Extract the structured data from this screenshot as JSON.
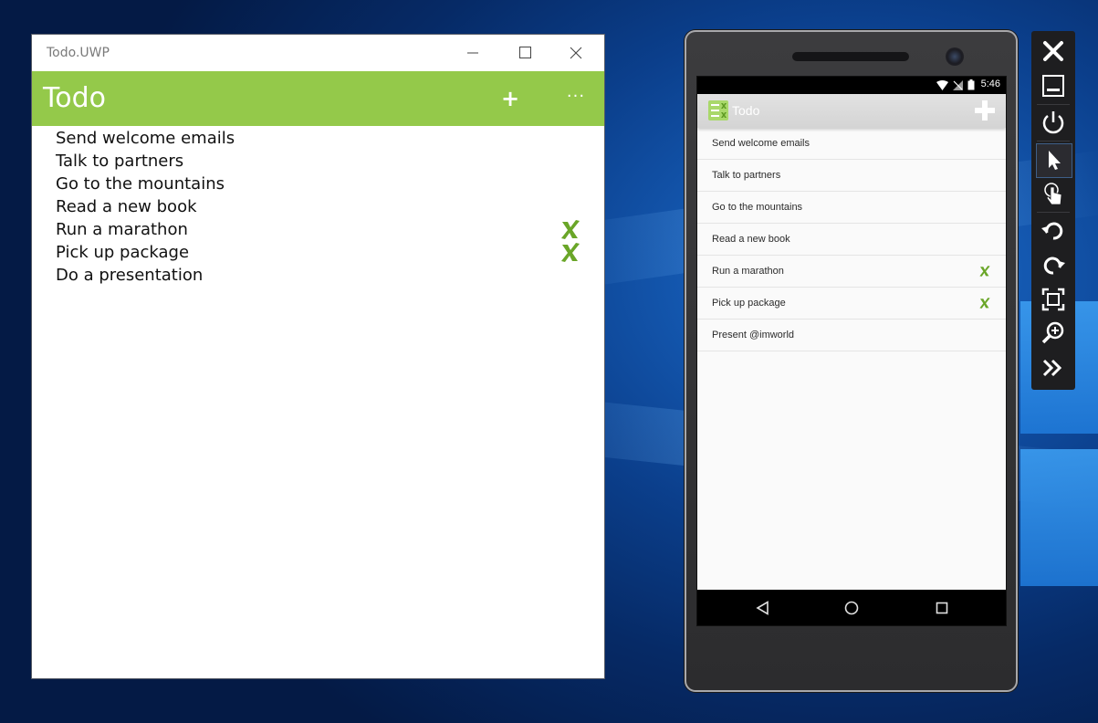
{
  "uwp_window": {
    "title": "Todo.UWP",
    "app_title": "Todo",
    "add_label": "+",
    "more_label": "···",
    "accent_color": "#94c94a",
    "items": [
      {
        "text": "Send welcome emails",
        "done": false
      },
      {
        "text": "Talk to partners",
        "done": false
      },
      {
        "text": "Go to the mountains",
        "done": false
      },
      {
        "text": "Read a new book",
        "done": false
      },
      {
        "text": "Run a marathon",
        "done": true
      },
      {
        "text": "Pick up package",
        "done": true
      },
      {
        "text": "Do a presentation",
        "done": false
      }
    ]
  },
  "android_emulator": {
    "status_time": "5:46",
    "app_title": "Todo",
    "check_color": "#6aa628",
    "items": [
      {
        "text": "Send welcome emails",
        "done": false
      },
      {
        "text": "Talk to partners",
        "done": false
      },
      {
        "text": "Go to the mountains",
        "done": false
      },
      {
        "text": "Read a new book",
        "done": false
      },
      {
        "text": "Run a marathon",
        "done": true
      },
      {
        "text": "Pick up package",
        "done": true
      },
      {
        "text": "Present @imworld",
        "done": false
      }
    ]
  },
  "emulator_toolbar": {
    "buttons": [
      "close-icon",
      "minimize-icon",
      "power-icon",
      "pointer-icon",
      "touch-icon",
      "rotate-left-icon",
      "rotate-right-icon",
      "fit-screen-icon",
      "zoom-icon",
      "more-icon"
    ]
  }
}
